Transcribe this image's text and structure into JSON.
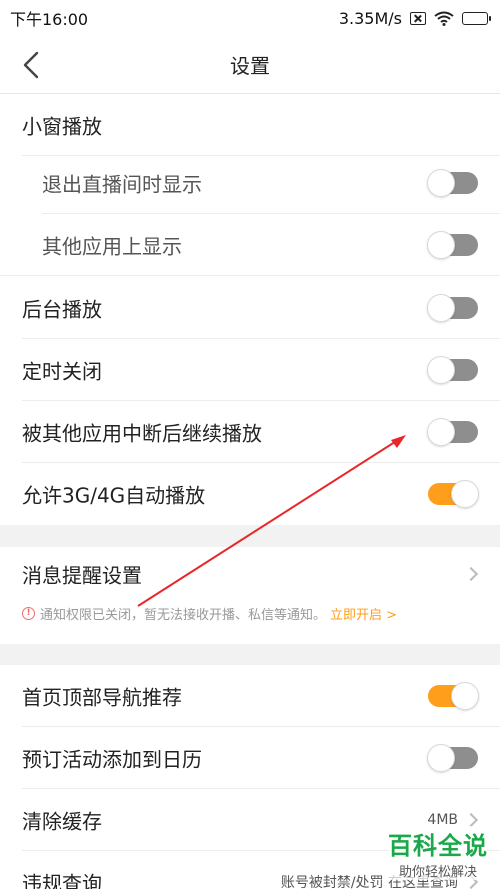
{
  "status_bar": {
    "time": "下午16:00",
    "network_speed": "3.35M/s",
    "icons": [
      "sim-icon",
      "wifi-icon",
      "battery-icon"
    ]
  },
  "nav": {
    "title": "设置",
    "back_icon": "chevron-left-icon"
  },
  "sections": {
    "mini_window": {
      "header": "小窗播放",
      "exit_live_label": "退出直播间时显示",
      "exit_live_on": false,
      "other_apps_label": "其他应用上显示",
      "other_apps_on": false
    },
    "background_play": {
      "label": "后台播放",
      "on": false
    },
    "timer_close": {
      "label": "定时关闭",
      "on": false
    },
    "resume_after_interrupt": {
      "label": "被其他应用中断后继续播放",
      "on": false
    },
    "allow_mobile_autoplay": {
      "label": "允许3G/4G自动播放",
      "on": true
    },
    "message_settings": {
      "label": "消息提醒设置",
      "notice": "通知权限已关闭，暂无法接收开播、私信等通知。",
      "notice_link": "立即开启 >"
    },
    "home_nav_recommend": {
      "label": "首页顶部导航推荐",
      "on": true
    },
    "add_to_calendar": {
      "label": "预订活动添加到日历",
      "on": false
    },
    "clear_cache": {
      "label": "清除缓存",
      "value": "4MB"
    },
    "violation_query": {
      "label": "违规查询",
      "value": "账号被封禁/处罚 在这里查询"
    }
  },
  "watermark": {
    "title": "百科全说",
    "subtitle": "助你轻松解决"
  },
  "colors": {
    "toggle_on": "#ff9e1a",
    "toggle_off": "#8e8e8e",
    "annotation_arrow": "#e8272a",
    "watermark_green": "#1aa84a"
  }
}
